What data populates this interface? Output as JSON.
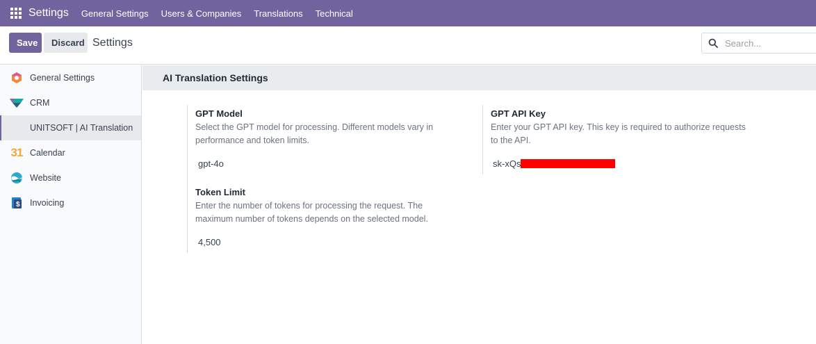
{
  "navbar": {
    "brand": "Settings",
    "menu": [
      {
        "label": "General Settings"
      },
      {
        "label": "Users & Companies"
      },
      {
        "label": "Translations"
      },
      {
        "label": "Technical"
      }
    ]
  },
  "control_panel": {
    "save_label": "Save",
    "discard_label": "Discard",
    "title": "Settings",
    "search_placeholder": "Search..."
  },
  "sidebar": {
    "items": [
      {
        "label": "General Settings",
        "icon": "general-settings-icon"
      },
      {
        "label": "CRM",
        "icon": "crm-icon"
      },
      {
        "label": "UNITSOFT | AI Translation",
        "icon": "",
        "active": true
      },
      {
        "label": "Calendar",
        "icon": "calendar-icon",
        "icon_text": "31"
      },
      {
        "label": "Website",
        "icon": "website-icon"
      },
      {
        "label": "Invoicing",
        "icon": "invoicing-icon"
      }
    ]
  },
  "section": {
    "title": "AI Translation Settings",
    "settings": {
      "gpt_model": {
        "label": "GPT Model",
        "help": "Select the GPT model for processing. Different models vary in performance and token limits.",
        "value": "gpt-4o"
      },
      "gpt_api_key": {
        "label": "GPT API Key",
        "help": "Enter your GPT API key. This key is required to authorize requests to the API.",
        "value_prefix": "sk-xQs"
      },
      "token_limit": {
        "label": "Token Limit",
        "help": "Enter the number of tokens for processing the request. The maximum number of tokens depends on the selected model.",
        "value": "4,500"
      }
    }
  },
  "colors": {
    "brand": "#71639e",
    "redaction": "#ff0000"
  }
}
